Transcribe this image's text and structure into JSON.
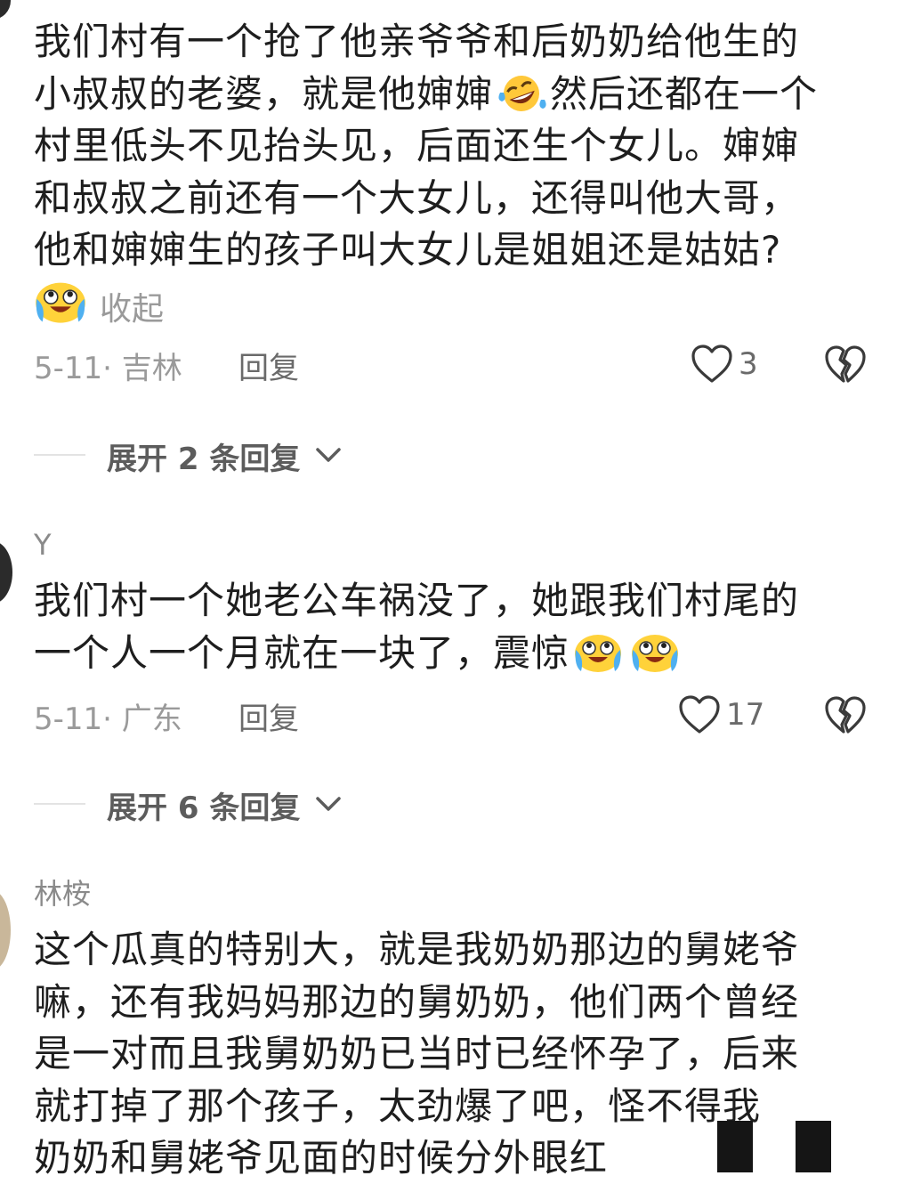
{
  "comments": [
    {
      "username": "",
      "lines": [
        "我们村有一个抢了他亲爷爷和后奶奶给他生的",
        [
          "小叔叔的老婆，就是他婶婶",
          "rofl-emoji",
          "然后还都在一个"
        ],
        "村里低头不见抬头见，后面还生个女儿。婶婶",
        "和叔叔之前还有一个大女儿，还得叫他大哥，",
        "他和婶婶生的孩子叫大女儿是姐姐还是姑姑?"
      ],
      "collapse_label": "收起",
      "date": "5-11",
      "location": "吉林",
      "reply_label": "回复",
      "likes": "3",
      "expand_label": "展开 2 条回复"
    },
    {
      "username": "Y",
      "line1": "我们村一个她老公车祸没了，她跟我们村尾的",
      "line2": "一个人一个月就在一块了，震惊",
      "date": "5-11",
      "location": "广东",
      "reply_label": "回复",
      "likes": "17",
      "expand_label": "展开 6 条回复"
    },
    {
      "username": "林桉",
      "lines": [
        "这个瓜真的特别大，就是我奶奶那边的舅姥爷",
        "嘛，还有我妈妈那边的舅奶奶，他们两个曾经",
        "是一对而且我舅奶奶已当时已经怀孕了，后来",
        "就打掉了那个孩子，太劲爆了吧，怪不得我",
        "奶奶和舅姥爷见面的时候分外眼红"
      ]
    }
  ],
  "meta_separator": "· ",
  "colors": {
    "text": "#1e1e1e",
    "meta": "#9a9a9a",
    "emoji_face": "#FFD23A",
    "tears": "#4FB0F0"
  }
}
